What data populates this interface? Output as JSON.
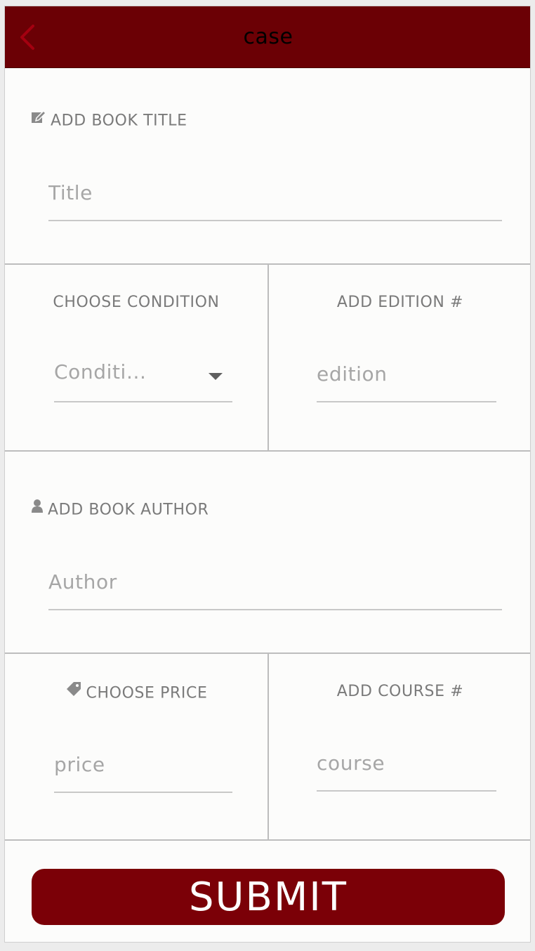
{
  "header": {
    "title": "case",
    "back_icon": "chevron-left-icon",
    "back_color": "#a40010",
    "bg_color": "#6b0005"
  },
  "title_section": {
    "label": "ADD BOOK TITLE",
    "icon": "edit-icon",
    "placeholder": "Title"
  },
  "condition_section": {
    "label": "CHOOSE CONDITION",
    "selected": "Conditi...",
    "icon": "caret-down-icon"
  },
  "edition_section": {
    "label": "ADD EDITION #",
    "placeholder": "edition"
  },
  "author_section": {
    "label": "ADD BOOK AUTHOR",
    "icon": "user-icon",
    "placeholder": "Author"
  },
  "price_section": {
    "label": "CHOOSE PRICE",
    "icon": "tag-icon",
    "placeholder": "price"
  },
  "course_section": {
    "label": "ADD COURSE #",
    "placeholder": "course"
  },
  "submit": {
    "label": "SUBMIT",
    "bg_color": "#7b0007"
  }
}
